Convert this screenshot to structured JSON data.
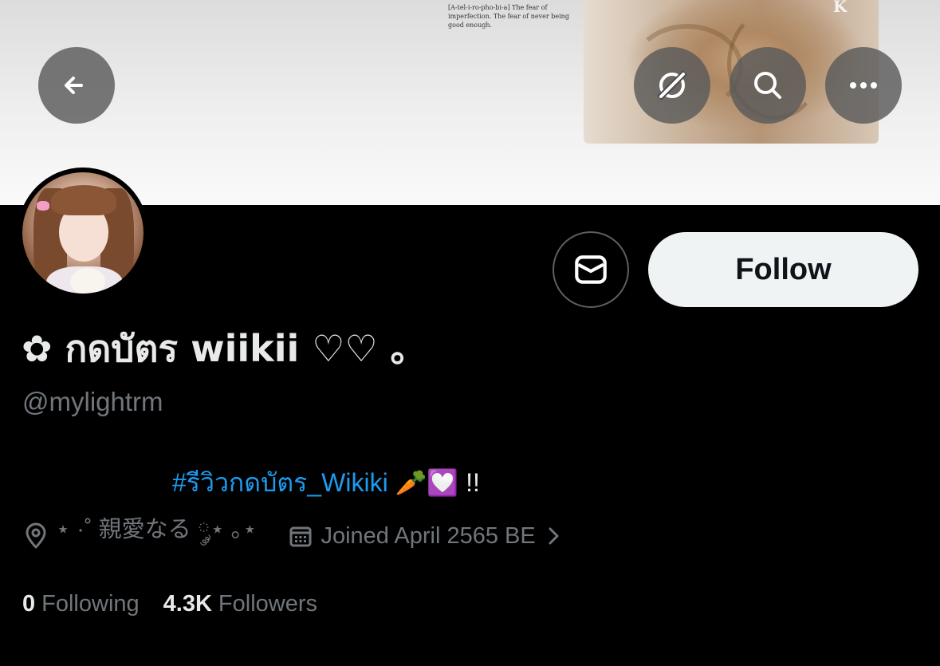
{
  "banner": {
    "text": "[A-tel-i-ro-pho-bi-a] The fear of imperfection. The fear of never being good enough.",
    "mark": "K"
  },
  "header_buttons": {
    "back_icon": "arrow-left-icon",
    "translate_icon": "grok-icon",
    "search_icon": "search-icon",
    "more_icon": "more-dots-icon"
  },
  "profile": {
    "display_name": "✿ กดบัตร wiikii ♡♡ ｡",
    "handle": "@mylightrm",
    "bio_hashtag": "#รีวิวกดบัตร_Wikiki",
    "bio_rest": " 🥕💟 !!",
    "location": "⋆ ·˚ 親愛なる ༘⋆ ｡⋆",
    "joined": "Joined April 2565 BE",
    "following_count": "0",
    "following_label": "Following",
    "followers_count": "4.3K",
    "followers_label": "Followers"
  },
  "actions": {
    "follow_label": "Follow",
    "message_icon": "envelope-icon"
  },
  "colors": {
    "background": "#000000",
    "link": "#1d9bf0",
    "muted": "#71767b",
    "text": "#e7e9ea",
    "follow_bg": "#eff3f4"
  }
}
